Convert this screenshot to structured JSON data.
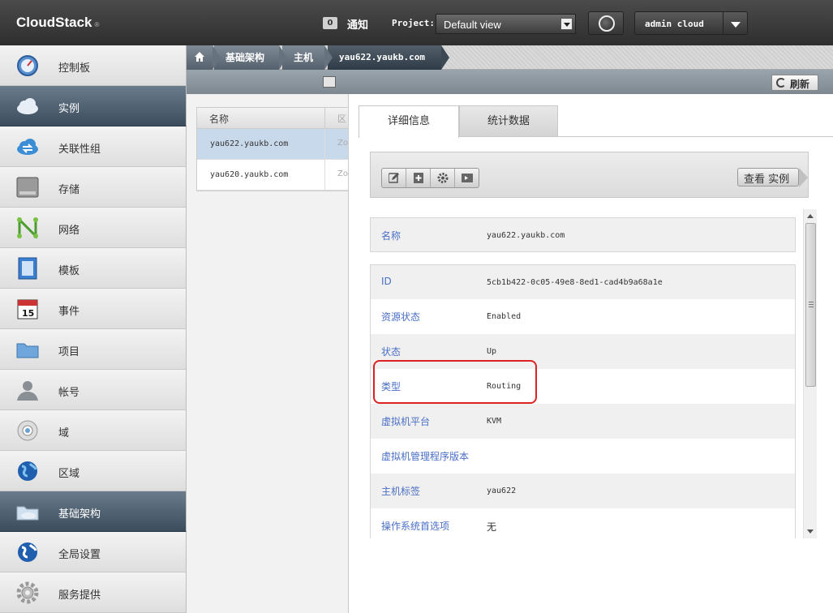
{
  "header": {
    "logo": "CloudStack",
    "logo_mark": "®",
    "notification_count": "0",
    "notification_label": "通知",
    "project_label": "Project:",
    "project_selected": "Default view",
    "user_name": "admin cloud"
  },
  "sidebar": {
    "items": [
      {
        "label": "控制板",
        "icon": "dashboard-icon"
      },
      {
        "label": "实例",
        "icon": "cloud-icon",
        "active": true
      },
      {
        "label": "关联性组",
        "icon": "affinity-cloud-icon"
      },
      {
        "label": "存储",
        "icon": "storage-icon"
      },
      {
        "label": "网络",
        "icon": "network-icon"
      },
      {
        "label": "模板",
        "icon": "template-icon"
      },
      {
        "label": "事件",
        "icon": "calendar-icon"
      },
      {
        "label": "项目",
        "icon": "folder-icon"
      },
      {
        "label": "帐号",
        "icon": "user-icon"
      },
      {
        "label": "域",
        "icon": "domain-icon"
      },
      {
        "label": "区域",
        "icon": "globe-icon"
      },
      {
        "label": "基础架构",
        "icon": "infrastructure-icon",
        "active": true
      },
      {
        "label": "全局设置",
        "icon": "settings-globe-icon"
      },
      {
        "label": "服务提供",
        "icon": "gear-icon"
      }
    ]
  },
  "breadcrumb": {
    "items": [
      "基础架构",
      "主机",
      "yau622.yaukb.com"
    ]
  },
  "list": {
    "columns": [
      "名称",
      "区"
    ],
    "rows": [
      {
        "name": "yau622.yaukb.com",
        "zone": "Zo",
        "selected": true
      },
      {
        "name": "yau620.yaukb.com",
        "zone": "Zo",
        "selected": false
      }
    ]
  },
  "detail": {
    "refresh_label": "刷新",
    "tabs": [
      "详细信息",
      "统计数据"
    ],
    "view_button": "查看 实例",
    "fields": [
      {
        "key": "名称",
        "value": "yau622.yaukb.com"
      },
      {
        "key": "ID",
        "value": "5cb1b422-0c05-49e8-8ed1-cad4b9a68a1e"
      },
      {
        "key": "资源状态",
        "value": "Enabled"
      },
      {
        "key": "状态",
        "value": "Up"
      },
      {
        "key": "类型",
        "value": "Routing"
      },
      {
        "key": "虚拟机平台",
        "value": "KVM"
      },
      {
        "key": "虚拟机管理程序版本",
        "value": ""
      },
      {
        "key": "主机标签",
        "value": "yau622"
      },
      {
        "key": "操作系统首选项",
        "value": "无"
      }
    ]
  },
  "colors": {
    "active_nav": "#4e5f70",
    "link_key": "#4a6fc5",
    "highlight": "#dd2222"
  }
}
